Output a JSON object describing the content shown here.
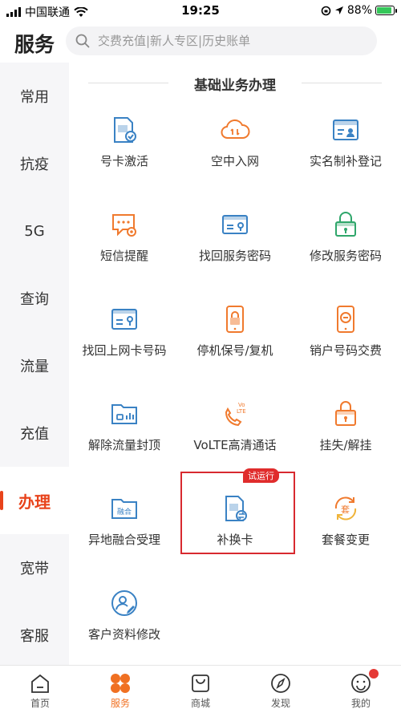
{
  "status_bar": {
    "carrier": "中国联通",
    "time": "19:25",
    "battery": "88%"
  },
  "header": {
    "title": "服务",
    "search_placeholder": "交费充值|新人专区|历史账单"
  },
  "sidebar": {
    "items": [
      {
        "label": "常用"
      },
      {
        "label": "抗疫"
      },
      {
        "label": "5G"
      },
      {
        "label": "查询"
      },
      {
        "label": "流量"
      },
      {
        "label": "充值"
      },
      {
        "label": "办理"
      },
      {
        "label": "宽带"
      },
      {
        "label": "客服"
      }
    ],
    "active_index": 6
  },
  "main": {
    "section_title": "基础业务办理",
    "tiles": [
      {
        "label": "号卡激活",
        "icon": "sim-check-icon"
      },
      {
        "label": "空中入网",
        "icon": "cloud-icon"
      },
      {
        "label": "实名制补登记",
        "icon": "id-card-icon"
      },
      {
        "label": "短信提醒",
        "icon": "sms-gear-icon"
      },
      {
        "label": "找回服务密码",
        "icon": "password-card-icon"
      },
      {
        "label": "修改服务密码",
        "icon": "lock-icon"
      },
      {
        "label": "找回上网卡号码",
        "icon": "key-card-icon"
      },
      {
        "label": "停机保号/复机",
        "icon": "phone-lock-icon"
      },
      {
        "label": "销户号码交费",
        "icon": "phone-minus-icon"
      },
      {
        "label": "解除流量封顶",
        "icon": "folder-chart-icon"
      },
      {
        "label": "VoLTE高清通话",
        "icon": "volte-phone-icon"
      },
      {
        "label": "挂失/解挂",
        "icon": "lock-open-icon"
      },
      {
        "label": "异地融合受理",
        "icon": "folder-merge-icon"
      },
      {
        "label": "补换卡",
        "icon": "sim-swap-icon",
        "badge": "试运行"
      },
      {
        "label": "套餐变更",
        "icon": "package-change-icon"
      },
      {
        "label": "客户资料修改",
        "icon": "profile-edit-icon"
      }
    ]
  },
  "tabbar": {
    "tabs": [
      {
        "label": "首页",
        "icon": "home-icon"
      },
      {
        "label": "服务",
        "icon": "service-icon"
      },
      {
        "label": "商城",
        "icon": "shop-bag-icon"
      },
      {
        "label": "发现",
        "icon": "compass-icon"
      },
      {
        "label": "我的",
        "icon": "profile-icon"
      }
    ],
    "active_index": 1
  },
  "colors": {
    "accent": "#e8431b",
    "icon_blue": "#3a82c4",
    "icon_orange": "#f07a2e",
    "icon_green": "#2fa66b",
    "highlight": "#d8292f"
  }
}
